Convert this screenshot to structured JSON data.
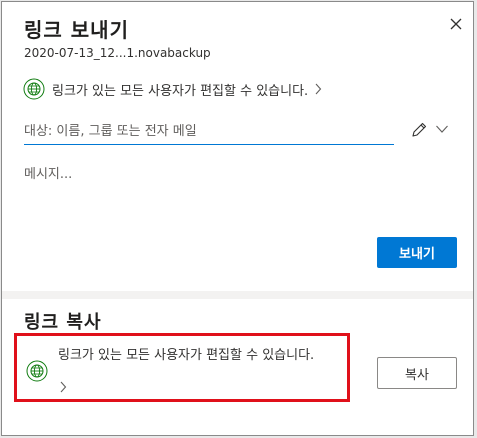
{
  "send": {
    "title": "링크 보내기",
    "filename": "2020-07-13_12...1.novabackup",
    "permission": "링크가 있는 모든 사용자가 편집할 수 있습니다.",
    "to_placeholder": "대상: 이름, 그룹 또는 전자 메일",
    "message_placeholder": "메시지...",
    "send_label": "보내기"
  },
  "copy": {
    "title": "링크 복사",
    "permission": "링크가 있는 모든 사용자가 편집할 수 있습니다.",
    "copy_label": "복사"
  },
  "colors": {
    "accent": "#0078d4",
    "highlight": "#e0101a",
    "globe": "#107c10"
  },
  "icons": {
    "close": "close-icon",
    "globe": "globe-icon",
    "pencil": "pencil-icon",
    "chevron_right": "chevron-right-icon",
    "chevron_down": "chevron-down-icon"
  }
}
